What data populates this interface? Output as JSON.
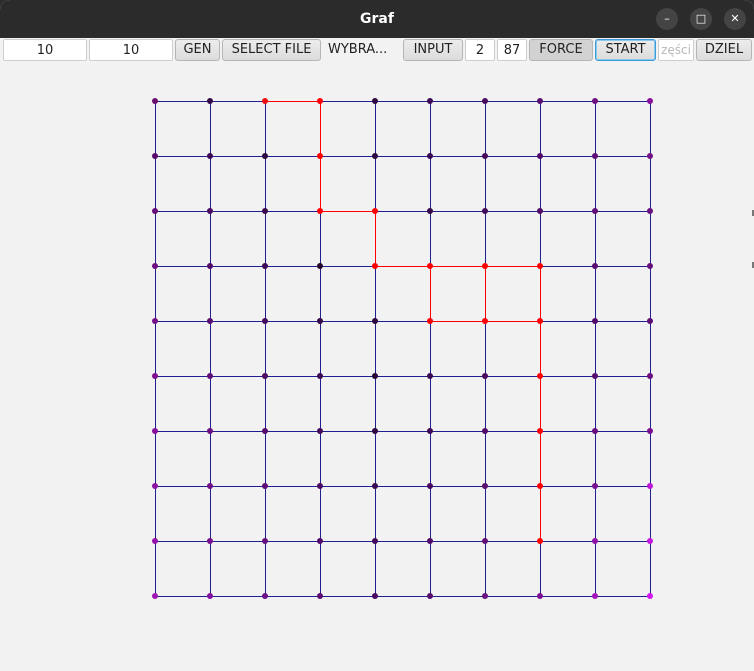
{
  "window": {
    "title": "Graf"
  },
  "controls": {
    "minimize_glyph": "–",
    "maximize_glyph": "□",
    "close_glyph": "✕"
  },
  "toolbar": {
    "rows_value": "10",
    "cols_value": "10",
    "gen_label": "GEN",
    "select_file_label": "SELECT FILE",
    "selected_file_label": "WYBRA...",
    "input_label": "INPUT",
    "start_node_value": "2",
    "end_node_value": "87",
    "force_label": "FORCE",
    "start_label": "START",
    "parts_placeholder": "zęści",
    "divide_label": "DZIEL"
  },
  "graph": {
    "rows": 10,
    "cols": 10,
    "edge_color": "#1f1f8f",
    "path_color": "#ff0000",
    "path_nodes": [
      2,
      3,
      13,
      23,
      24,
      34,
      35,
      36,
      37,
      45,
      46,
      47,
      57,
      67,
      77,
      87
    ],
    "node_colors": [
      "#6a1070",
      "#360a48",
      "#ee1010",
      "#ff0000",
      "#300840",
      "#3e0a55",
      "#4a0a60",
      "#5a0e70",
      "#6e1080",
      "#8a109c",
      "#5a0a6c",
      "#3e0a55",
      "#2e0840",
      "#ff0000",
      "#300840",
      "#3a0a52",
      "#440a5c",
      "#520c68",
      "#600e78",
      "#741088",
      "#660c78",
      "#4a0a60",
      "#380a4c",
      "#ff0000",
      "#ff0000",
      "#360a48",
      "#420a5a",
      "#500c66",
      "#5e0e74",
      "#6a1080",
      "#6e0e82",
      "#520c68",
      "#3e0a55",
      "#28082f",
      "#ff0000",
      "#ff0000",
      "#ff0000",
      "#ff0000",
      "#5a0e70",
      "#66107c",
      "#761088",
      "#5a0e70",
      "#460a5e",
      "#340a48",
      "#300840",
      "#ff0000",
      "#ff0000",
      "#ff0000",
      "#520c68",
      "#5e0e74",
      "#7e1090",
      "#620e78",
      "#4e0c64",
      "#3c0a52",
      "#280836",
      "#3a0a52",
      "#4a0a60",
      "#ff0000",
      "#580e6e",
      "#6a1080",
      "#86109a",
      "#6a1080",
      "#560c6c",
      "#440a5c",
      "#300840",
      "#3e0a55",
      "#500c66",
      "#ff0000",
      "#660e80",
      "#7a1090",
      "#8e12a4",
      "#72108a",
      "#5e0e74",
      "#4c0c62",
      "#3a0a52",
      "#4a0a60",
      "#5a0e70",
      "#ff0000",
      "#7a1092",
      "#c016d8",
      "#9612ac",
      "#7a1090",
      "#661080",
      "#540c6a",
      "#420a5a",
      "#500c66",
      "#621078",
      "#ff0000",
      "#8e12a6",
      "#c817e2",
      "#9e14b4",
      "#8212a0",
      "#6e1088",
      "#5c0e74",
      "#4a0a60",
      "#580e6e",
      "#6a1080",
      "#7c1094",
      "#a214ba",
      "#d018ee"
    ]
  }
}
